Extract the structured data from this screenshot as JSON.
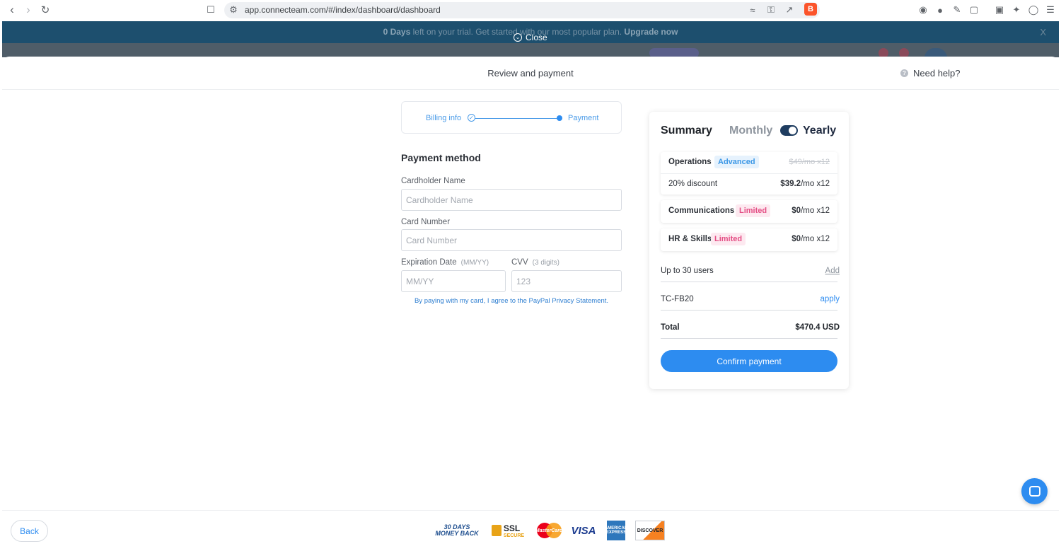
{
  "browser": {
    "url": "app.connecteam.com/#/index/dashboard/dashboard"
  },
  "banner": {
    "days": "0 Days",
    "text": " left on your trial. Get started with our most popular plan. ",
    "cta": "Upgrade now",
    "dismiss": "X"
  },
  "overlay": {
    "close_label": "Close"
  },
  "modal": {
    "title": "Review and payment",
    "help": "Need help?"
  },
  "stepper": {
    "step1": "Billing info",
    "step2": "Payment"
  },
  "payment_form": {
    "title": "Payment method",
    "cardholder_label": "Cardholder Name",
    "cardholder_placeholder": "Cardholder Name",
    "card_number_label": "Card Number",
    "card_number_placeholder": "Card Number",
    "expiration_label": "Expiration Date",
    "expiration_hint": "(MM/YY)",
    "expiration_placeholder": "MM/YY",
    "cvv_label": "CVV",
    "cvv_hint": "(3 digits)",
    "cvv_placeholder": "123",
    "agreement": "By paying with my card, I agree to the PayPal Privacy Statement."
  },
  "summary": {
    "title": "Summary",
    "monthly": "Monthly",
    "yearly": "Yearly",
    "billing_yearly": true,
    "plans": [
      {
        "name": "Operations",
        "tier": "Advanced",
        "original_price": "$49/mo x12"
      },
      {
        "name": "Communications",
        "tier": "Limited",
        "price_bold": "$0",
        "price_rest": "/mo x12"
      },
      {
        "name": "HR & Skills",
        "tier": "Limited",
        "price_bold": "$0",
        "price_rest": "/mo x12"
      }
    ],
    "discount": {
      "label": "20% discount",
      "price_bold": "$39.2",
      "price_rest": "/mo x12"
    },
    "users": {
      "label": "Up to 30 users",
      "action": "Add"
    },
    "coupon": {
      "code": "TC-FB20",
      "action": "apply"
    },
    "total": {
      "label": "Total",
      "value": "$470.4 USD"
    },
    "confirm": "Confirm payment"
  },
  "footer": {
    "back": "Back",
    "badges": {
      "money_back_top": "30 DAYS",
      "money_back_bottom": "MONEY BACK",
      "ssl_top": "SSL",
      "ssl_bottom": "SECURE",
      "mastercard": "MasterCard",
      "visa": "VISA",
      "amex": "AMERICAN EXPRESS",
      "discover": "DISCOVER"
    }
  },
  "colors": {
    "accent": "#2d8cf0",
    "tag_advanced": "#3b97e6",
    "tag_limited": "#e44d84",
    "banner": "#1d4f6e"
  }
}
